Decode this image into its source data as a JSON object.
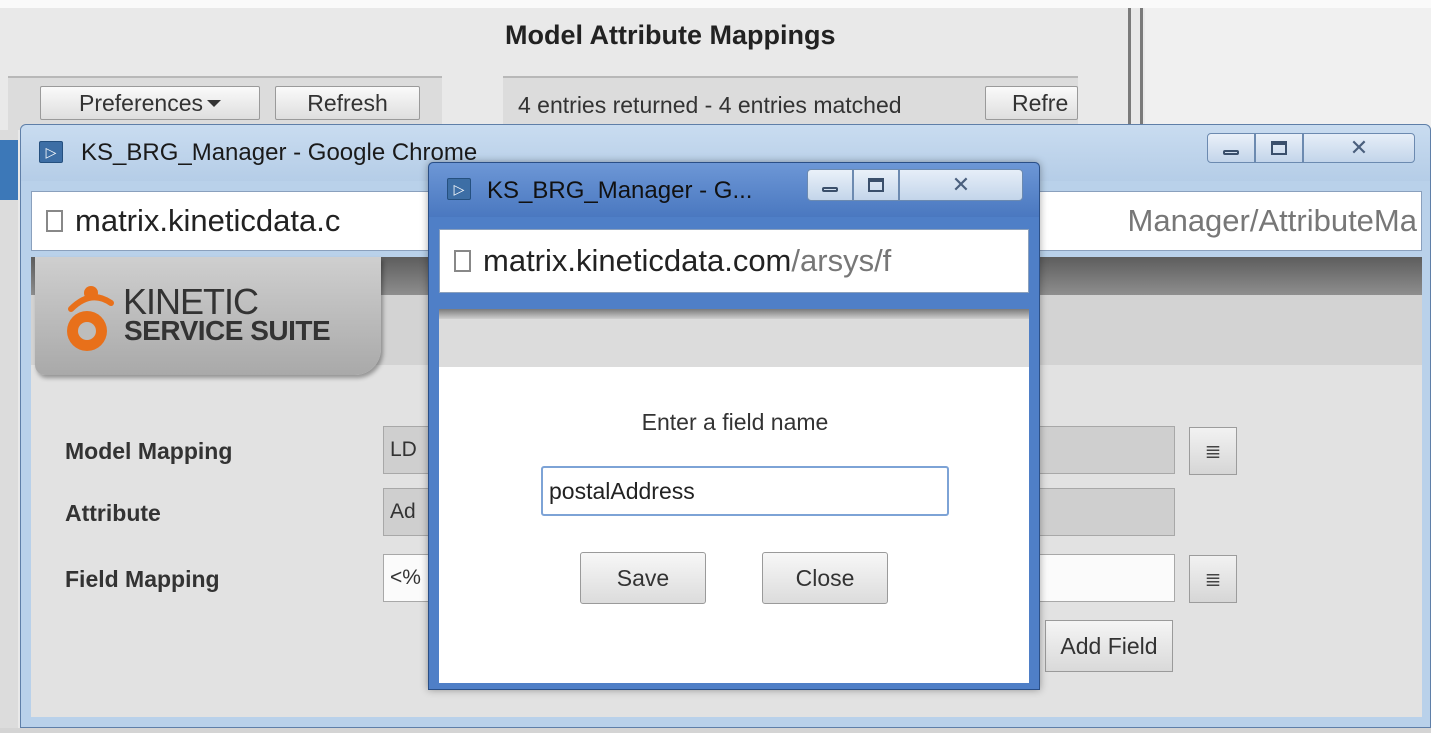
{
  "background_app": {
    "title": "Model Attribute Mappings",
    "left_toolbar": {
      "preferences_label": "Preferences",
      "refresh_label": "Refresh"
    },
    "right_toolbar": {
      "status": "4 entries returned - 4 entries matched",
      "refresh_label": "Refre"
    }
  },
  "main_window": {
    "title": "KS_BRG_Manager - Google Chrome",
    "address_host": "matrix.kineticdata.c",
    "address_path_tail": "Manager/AttributeMa",
    "logo": {
      "line1": "KINETIC",
      "line2": "SERVICE SUITE"
    },
    "form": {
      "model_mapping_label": "Model Mapping",
      "model_mapping_value": "LD",
      "attribute_label": "Attribute",
      "attribute_value": "Ad",
      "field_mapping_label": "Field Mapping",
      "field_mapping_value": "<%",
      "add_field_label": "Add Field"
    }
  },
  "popup_window": {
    "title": "KS_BRG_Manager - G...",
    "address_host": "matrix.kineticdata.com",
    "address_path": "/arsys/f",
    "prompt": "Enter a field name",
    "field_value": "postalAddress",
    "save_label": "Save",
    "close_label": "Close"
  },
  "icons": {
    "app_icon": "play-triangle-icon",
    "minimize": "minimize-icon",
    "maximize": "maximize-icon",
    "close": "close-icon",
    "page": "page-icon",
    "dropdown": "caret-down-icon",
    "menu": "list-menu-icon"
  },
  "colors": {
    "window_frame": "#b9d1ea",
    "popup_frame": "#4f7fc7",
    "logo_orange": "#e8701a"
  }
}
